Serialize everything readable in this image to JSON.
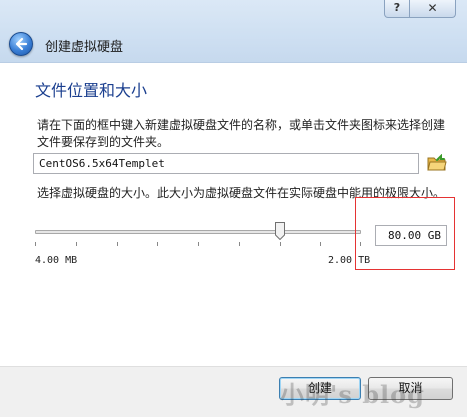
{
  "window": {
    "title": "创建虚拟硬盘",
    "help_label": "?",
    "close_label": "✕",
    "back_icon": "back-arrow-icon"
  },
  "page": {
    "heading": "文件位置和大小",
    "description": "请在下面的框中键入新建虚拟硬盘文件的名称，或单击文件夹图标来选择创建文件要保存到的文件夹。",
    "filename_value": "CentOS6.5x64Templet",
    "folder_icon": "folder-icon",
    "size_label": "选择虚拟硬盘的大小。此大小为虚拟硬盘文件在实际硬盘中能用的极限大小。",
    "size_value": "80.00 GB",
    "slider": {
      "min_label": "4.00 MB",
      "max_label": "2.00 TB",
      "position_fraction": 0.75
    },
    "highlight_color": "#e53333"
  },
  "footer": {
    "create_label": "创建",
    "cancel_label": "取消"
  },
  "watermark": "小明's blog"
}
